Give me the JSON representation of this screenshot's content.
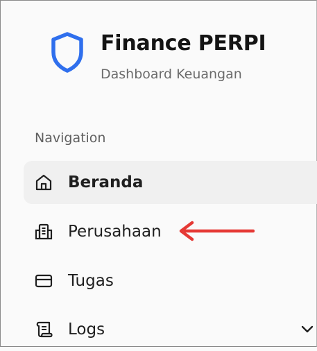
{
  "brand": {
    "title": "Finance PERPI",
    "subtitle": "Dashboard Keuangan",
    "icon": "shield-icon",
    "accent_color": "#2f6fed"
  },
  "navigation": {
    "heading": "Navigation",
    "items": [
      {
        "label": "Beranda",
        "icon": "home-icon",
        "active": true
      },
      {
        "label": "Perusahaan",
        "icon": "building-icon",
        "active": false
      },
      {
        "label": "Tugas",
        "icon": "credit-card-icon",
        "active": false
      },
      {
        "label": "Logs",
        "icon": "scroll-icon",
        "active": false,
        "expandable": true
      }
    ]
  },
  "annotation": {
    "arrow_color": "#e53935",
    "points_to": "Perusahaan"
  }
}
